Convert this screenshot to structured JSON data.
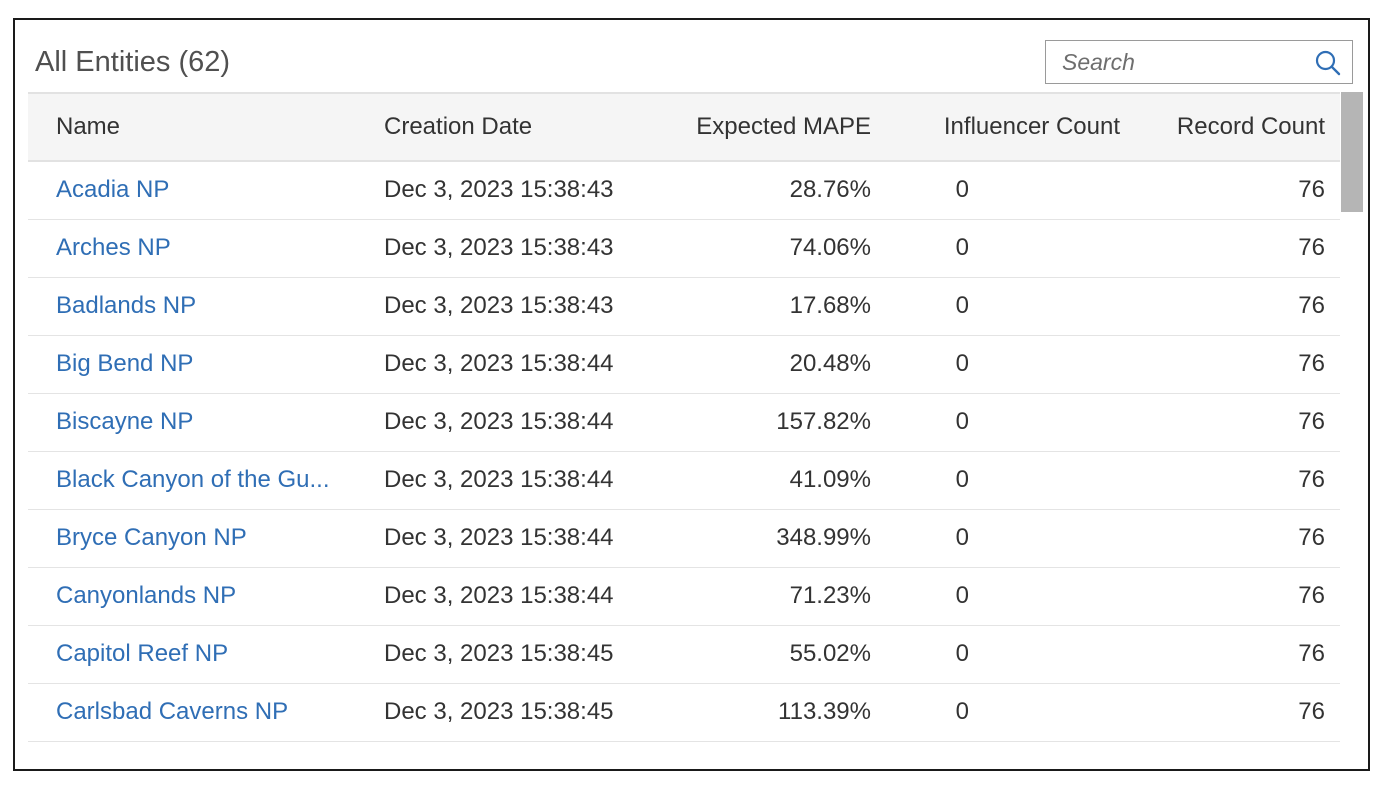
{
  "header": {
    "title": "All Entities (62)",
    "search_placeholder": "Search"
  },
  "table": {
    "columns": [
      "Name",
      "Creation Date",
      "Expected MAPE",
      "Influencer Count",
      "Record Count"
    ],
    "rows": [
      {
        "name": "Acadia NP",
        "date": "Dec 3, 2023 15:38:43",
        "mape": "28.76%",
        "influencers": "0",
        "records": "76"
      },
      {
        "name": "Arches NP",
        "date": "Dec 3, 2023 15:38:43",
        "mape": "74.06%",
        "influencers": "0",
        "records": "76"
      },
      {
        "name": "Badlands NP",
        "date": "Dec 3, 2023 15:38:43",
        "mape": "17.68%",
        "influencers": "0",
        "records": "76"
      },
      {
        "name": "Big Bend NP",
        "date": "Dec 3, 2023 15:38:44",
        "mape": "20.48%",
        "influencers": "0",
        "records": "76"
      },
      {
        "name": "Biscayne NP",
        "date": "Dec 3, 2023 15:38:44",
        "mape": "157.82%",
        "influencers": "0",
        "records": "76"
      },
      {
        "name": "Black Canyon of the Gu...",
        "date": "Dec 3, 2023 15:38:44",
        "mape": "41.09%",
        "influencers": "0",
        "records": "76"
      },
      {
        "name": "Bryce Canyon NP",
        "date": "Dec 3, 2023 15:38:44",
        "mape": "348.99%",
        "influencers": "0",
        "records": "76"
      },
      {
        "name": "Canyonlands NP",
        "date": "Dec 3, 2023 15:38:44",
        "mape": "71.23%",
        "influencers": "0",
        "records": "76"
      },
      {
        "name": "Capitol Reef NP",
        "date": "Dec 3, 2023 15:38:45",
        "mape": "55.02%",
        "influencers": "0",
        "records": "76"
      },
      {
        "name": "Carlsbad Caverns NP",
        "date": "Dec 3, 2023 15:38:45",
        "mape": "113.39%",
        "influencers": "0",
        "records": "76"
      }
    ]
  },
  "icons": {
    "search": "search-icon"
  },
  "colors": {
    "link": "#2f6eb5",
    "header_bg": "#f5f5f5",
    "text": "#333333",
    "title": "#505050",
    "scrollbar": "#b5b5b5"
  }
}
